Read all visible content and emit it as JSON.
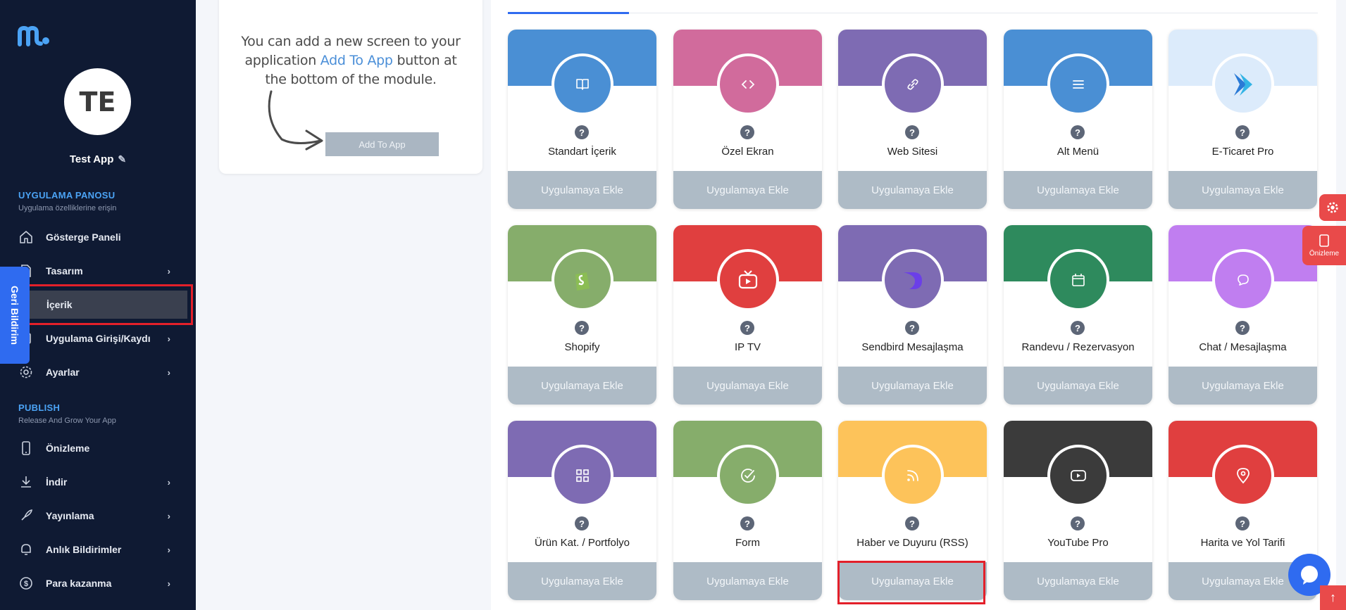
{
  "sidebar": {
    "avatar_initials": "TE",
    "app_name": "Test App",
    "section1": {
      "title": "UYGULAMA PANOSU",
      "subtitle": "Uygulama özelliklerine erişin"
    },
    "items1": [
      {
        "label": "Gösterge Paneli",
        "icon": "home-icon"
      },
      {
        "label": "Tasarım",
        "icon": "design-icon"
      },
      {
        "label": "İçerik",
        "icon": "content-icon"
      },
      {
        "label": "Uygulama Girişi/Kaydı",
        "icon": "login-icon"
      },
      {
        "label": "Ayarlar",
        "icon": "gear-icon"
      }
    ],
    "section2": {
      "title": "PUBLISH",
      "subtitle": "Release And Grow Your App"
    },
    "items2": [
      {
        "label": "Önizleme",
        "icon": "phone-icon"
      },
      {
        "label": "İndir",
        "icon": "download-icon"
      },
      {
        "label": "Yayınlama",
        "icon": "rocket-icon"
      },
      {
        "label": "Anlık Bildirimler",
        "icon": "bell-icon"
      },
      {
        "label": "Para kazanma",
        "icon": "dollar-icon"
      }
    ],
    "feedback_label": "Geri Bildirim"
  },
  "info_card": {
    "text_part1": "You can add a new screen to your application ",
    "text_highlight": "Add To App",
    "text_part2": " button at the bottom of the module.",
    "button_label": "Add To App"
  },
  "modules": [
    {
      "name": "Standart İçerik",
      "button": "Uygulamaya Ekle",
      "color": "#4a8fd4",
      "icon": "book-icon"
    },
    {
      "name": "Özel Ekran",
      "button": "Uygulamaya Ekle",
      "color": "#d16b9c",
      "icon": "code-icon"
    },
    {
      "name": "Web Sitesi",
      "button": "Uygulamaya Ekle",
      "color": "#7e6bb3",
      "icon": "link-icon"
    },
    {
      "name": "Alt Menü",
      "button": "Uygulamaya Ekle",
      "color": "#4a8fd4",
      "icon": "menu-icon"
    },
    {
      "name": "E-Ticaret Pro",
      "button": "Uygulamaya Ekle",
      "color": "#dcebfb",
      "icon": "ecommerce-logo-icon"
    },
    {
      "name": "Shopify",
      "button": "Uygulamaya Ekle",
      "color": "#86ad6b",
      "icon": "shopify-icon"
    },
    {
      "name": "IP TV",
      "button": "Uygulamaya Ekle",
      "color": "#e03f3f",
      "icon": "tv-icon"
    },
    {
      "name": "Sendbird Mesajlaşma",
      "button": "Uygulamaya Ekle",
      "color": "#7e6bb3",
      "icon": "sendbird-icon"
    },
    {
      "name": "Randevu / Rezervasyon",
      "button": "Uygulamaya Ekle",
      "color": "#2e8a5d",
      "icon": "calendar-icon"
    },
    {
      "name": "Chat / Mesajlaşma",
      "button": "Uygulamaya Ekle",
      "color": "#c07ef0",
      "icon": "chat-icon"
    },
    {
      "name": "Ürün Kat. / Portfolyo",
      "button": "Uygulamaya Ekle",
      "color": "#7e6bb3",
      "icon": "grid-icon"
    },
    {
      "name": "Form",
      "button": "Uygulamaya Ekle",
      "color": "#86ad6b",
      "icon": "check-icon"
    },
    {
      "name": "Haber ve Duyuru (RSS)",
      "button": "Uygulamaya Ekle",
      "color": "#fdc35a",
      "icon": "rss-icon"
    },
    {
      "name": "YouTube Pro",
      "button": "Uygulamaya Ekle",
      "color": "#3b3b3b",
      "icon": "youtube-icon"
    },
    {
      "name": "Harita ve Yol Tarifi",
      "button": "Uygulamaya Ekle",
      "color": "#e03f3f",
      "icon": "map-pin-icon"
    }
  ],
  "right_actions": {
    "preview_label": "Önizleme"
  },
  "colors": {
    "sidebar_bg": "#0f1a33",
    "accent_blue": "#2f6bf0",
    "highlight_red": "#e3202a",
    "button_gray": "#aebbc6"
  }
}
